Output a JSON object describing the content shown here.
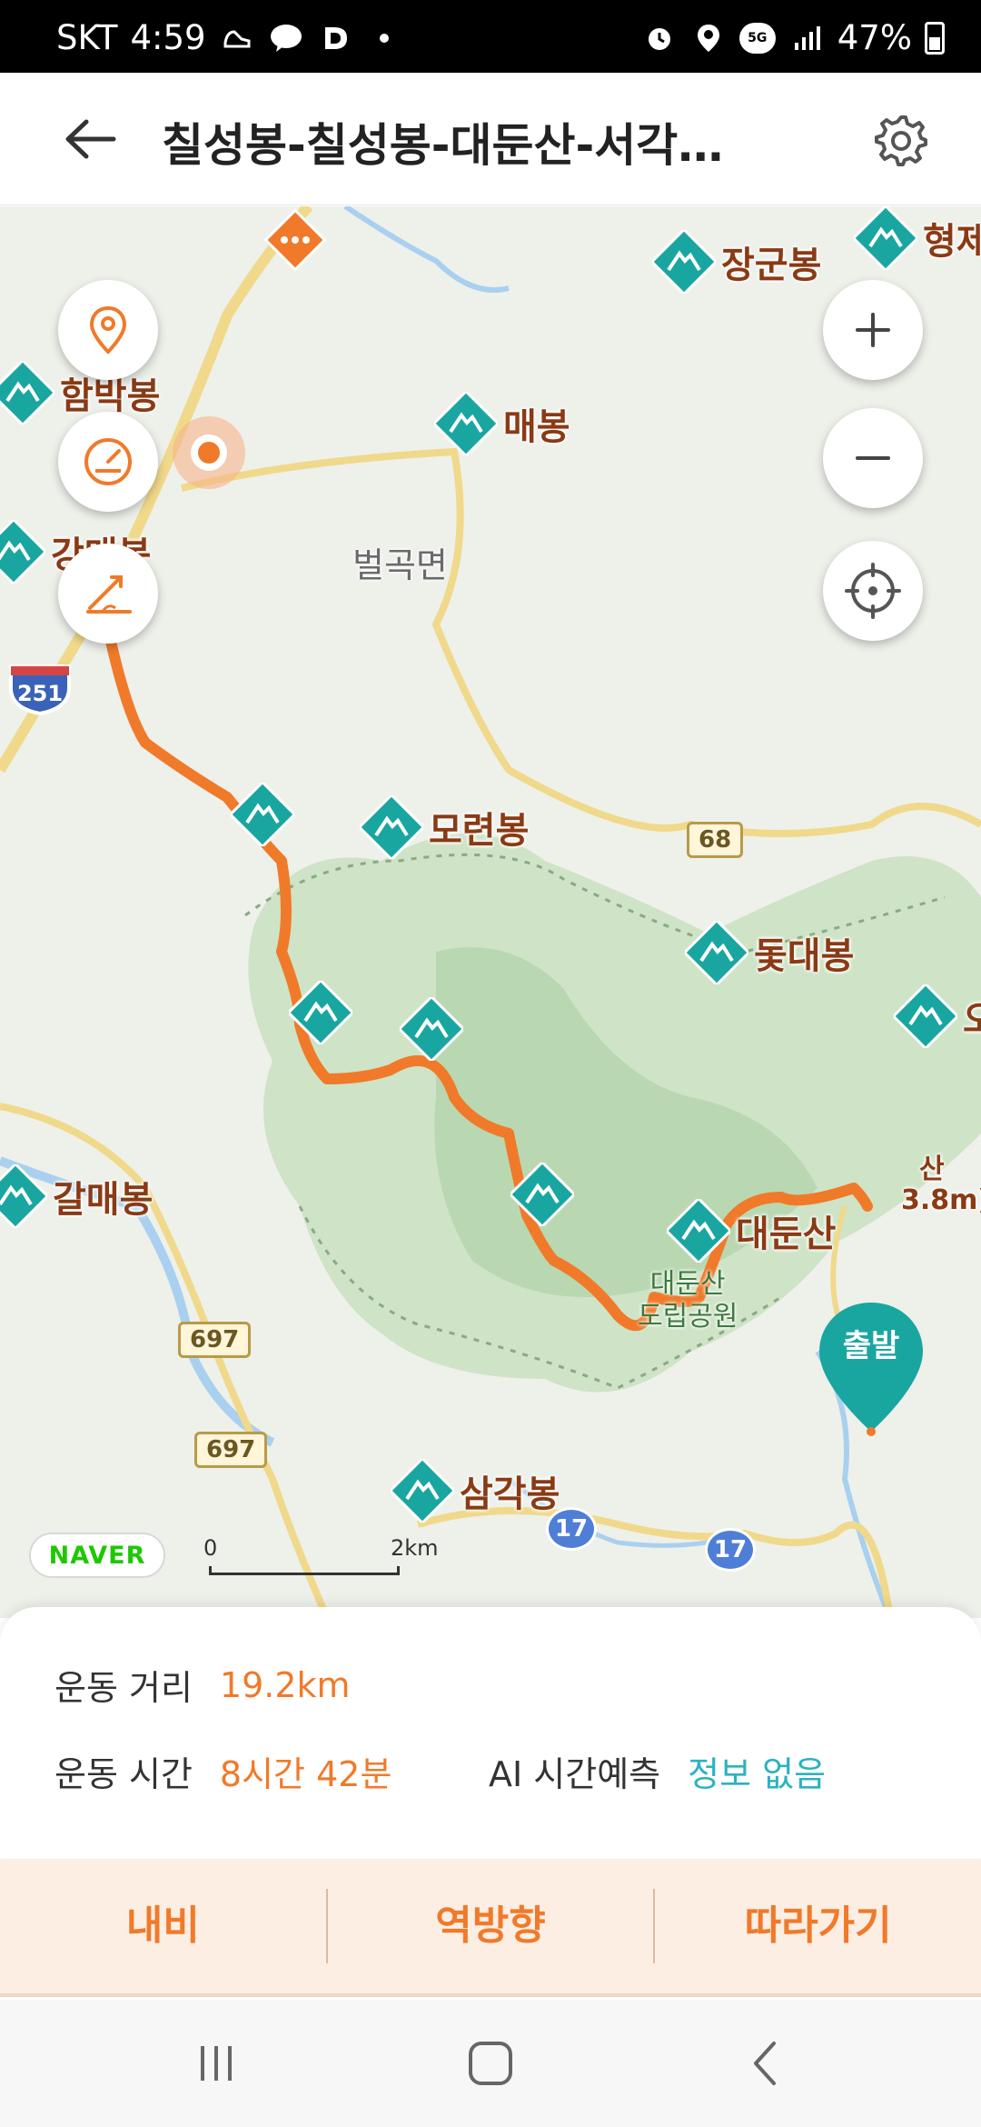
{
  "status_bar": {
    "carrier": "SKT",
    "time": "4:59",
    "network": "5G",
    "battery": "47%"
  },
  "header": {
    "title": "칠성봉-칠성봉-대둔산-서각…"
  },
  "map": {
    "peaks": [
      "형제",
      "장군봉",
      "함박봉",
      "매봉",
      "강매봉",
      "모련봉",
      "돛대봉",
      "오",
      "갈매봉",
      "대둔산",
      "삼각봉"
    ],
    "place_label": "벌곡면",
    "park_label_line1": "대둔산",
    "park_label_line2": "도립공원",
    "roads": [
      "251",
      "68",
      "697",
      "697",
      "17",
      "17"
    ],
    "start_label": "출발",
    "elevation_partial": "산",
    "elevation_partial2": "3.8m)",
    "naver_logo": "NAVER",
    "scale_min": "0",
    "scale_max": "2km",
    "route_color": "#f07a2a",
    "accent_teal": "#1aa6a0"
  },
  "info": {
    "distance_label": "운동 거리",
    "distance_value": "19.2km",
    "time_label": "운동 시간",
    "time_value": "8시간 42분",
    "ai_label": "AI 시간예측",
    "ai_value": "정보 없음"
  },
  "actions": {
    "navi": "내비",
    "reverse": "역방향",
    "follow": "따라가기"
  },
  "icons": {
    "back": "back-arrow-icon",
    "settings": "gear-icon",
    "location": "location-pin-icon",
    "speedometer": "speedometer-icon",
    "elevation": "elevation-icon",
    "zoom_in": "plus-icon",
    "zoom_out": "minus-icon",
    "recenter": "crosshair-icon"
  }
}
